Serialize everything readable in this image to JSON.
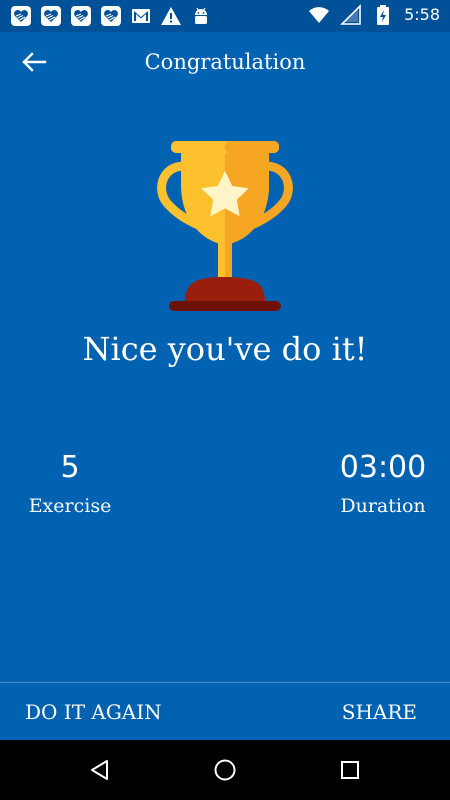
{
  "status_bar": {
    "time": "5:58",
    "left_icons": [
      "heart-app-icon",
      "heart-app-icon",
      "heart-app-icon",
      "heart-app-icon",
      "gmail-icon",
      "warning-icon",
      "android-icon"
    ],
    "right_icons": [
      "wifi-icon",
      "signal-icon",
      "battery-charging-icon"
    ]
  },
  "app_bar": {
    "title": "Congratulation",
    "back_icon": "arrow-left-icon"
  },
  "trophy": {
    "icon": "trophy-icon",
    "colors": {
      "cup": "#FDC12E",
      "cup_shade": "#F6A623",
      "star": "#FFF5C8",
      "base": "#9A1E0C",
      "base_dark": "#6E1208"
    }
  },
  "message": "Nice you've do it!",
  "stats": {
    "exercise": {
      "value": "5",
      "label": "Exercise"
    },
    "duration": {
      "value": "03:00",
      "label": "Duration"
    }
  },
  "actions": {
    "do_it_again": "DO IT AGAIN",
    "share": "SHARE"
  },
  "nav_bar": {
    "buttons": [
      "back-triangle-icon",
      "home-circle-icon",
      "recents-square-icon"
    ]
  },
  "colors": {
    "background": "#0062B0",
    "status_bar": "#005197",
    "nav_bar": "#000000",
    "text": "#FFFFFF"
  }
}
